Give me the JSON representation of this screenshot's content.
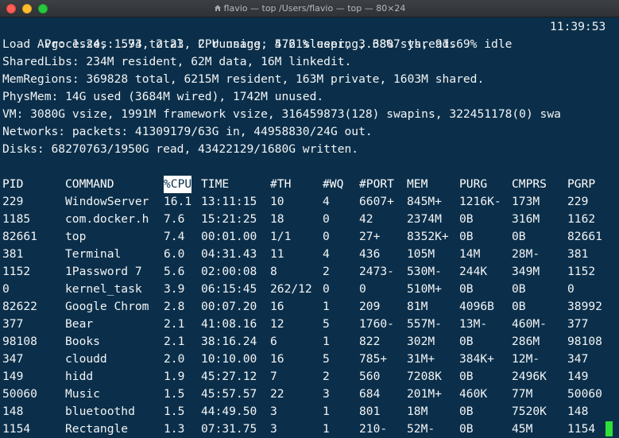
{
  "window": {
    "title": "flavio — top /Users/flavio — top — 80×24"
  },
  "summary": {
    "processes": "Processes: 574 total, 2 running, 572 sleeping, 3807 threads",
    "clock": "11:39:53",
    "load": "Load Avg: 1.24, 1.93, 2.23  CPU usage: 4.61% user, 3.68% sys, 91.69% idle",
    "sharedlibs": "SharedLibs: 234M resident, 62M data, 16M linkedit.",
    "memregions": "MemRegions: 369828 total, 6215M resident, 163M private, 1603M shared.",
    "physmem": "PhysMem: 14G used (3684M wired), 1742M unused.",
    "vm": "VM: 3080G vsize, 1991M framework vsize, 316459873(128) swapins, 322451178(0) swa",
    "networks": "Networks: packets: 41309179/63G in, 44958830/24G out.",
    "disks": "Disks: 68270763/1950G read, 43422129/1680G written."
  },
  "table": {
    "headers": [
      "PID",
      "COMMAND",
      "%CPU",
      "TIME",
      "#TH",
      "#WQ",
      "#PORT",
      "MEM",
      "PURG",
      "CMPRS",
      "PGRP"
    ],
    "rows": [
      [
        "229",
        "WindowServer",
        "16.1",
        "13:11:15",
        "10",
        "4",
        "6607+",
        "845M+",
        "1216K-",
        "173M",
        "229"
      ],
      [
        "1185",
        "com.docker.h",
        "7.6",
        "15:21:25",
        "18",
        "0",
        "42",
        "2374M",
        "0B",
        "316M",
        "1162"
      ],
      [
        "82661",
        "top",
        "7.4",
        "00:01.00",
        "1/1",
        "0",
        "27+",
        "8352K+",
        "0B",
        "0B",
        "82661"
      ],
      [
        "381",
        "Terminal",
        "6.0",
        "04:31.43",
        "11",
        "4",
        "436",
        "105M",
        "14M",
        "28M-",
        "381"
      ],
      [
        "1152",
        "1Password 7",
        "5.6",
        "02:00:08",
        "8",
        "2",
        "2473-",
        "530M-",
        "244K",
        "349M",
        "1152"
      ],
      [
        "0",
        "kernel_task",
        "3.9",
        "06:15:45",
        "262/12",
        "0",
        "0",
        "510M+",
        "0B",
        "0B",
        "0"
      ],
      [
        "82622",
        "Google Chrom",
        "2.8",
        "00:07.20",
        "16",
        "1",
        "209",
        "81M",
        "4096B",
        "0B",
        "38992"
      ],
      [
        "377",
        "Bear",
        "2.1",
        "41:08.16",
        "12",
        "5",
        "1760-",
        "557M-",
        "13M-",
        "460M-",
        "377"
      ],
      [
        "98108",
        "Books",
        "2.1",
        "38:16.24",
        "6",
        "1",
        "822",
        "302M",
        "0B",
        "286M",
        "98108"
      ],
      [
        "347",
        "cloudd",
        "2.0",
        "10:10.00",
        "16",
        "5",
        "785+",
        "31M+",
        "384K+",
        "12M-",
        "347"
      ],
      [
        "149",
        "hidd",
        "1.9",
        "45:27.12",
        "7",
        "2",
        "560",
        "7208K",
        "0B",
        "2496K",
        "149"
      ],
      [
        "50060",
        "Music",
        "1.5",
        "45:57.57",
        "22",
        "3",
        "684",
        "201M+",
        "460K",
        "77M",
        "50060"
      ],
      [
        "148",
        "bluetoothd",
        "1.5",
        "44:49.50",
        "3",
        "1",
        "801",
        "18M",
        "0B",
        "7520K",
        "148"
      ],
      [
        "1154",
        "Rectangle",
        "1.3",
        "07:31.75",
        "3",
        "1",
        "210-",
        "52M-",
        "0B",
        "45M",
        "1154"
      ]
    ]
  },
  "colors": {
    "background": "#0b2f4a",
    "foreground": "#f2f4f6",
    "cursor": "#2ee03a",
    "selected_header_bg": "#ffffff"
  }
}
